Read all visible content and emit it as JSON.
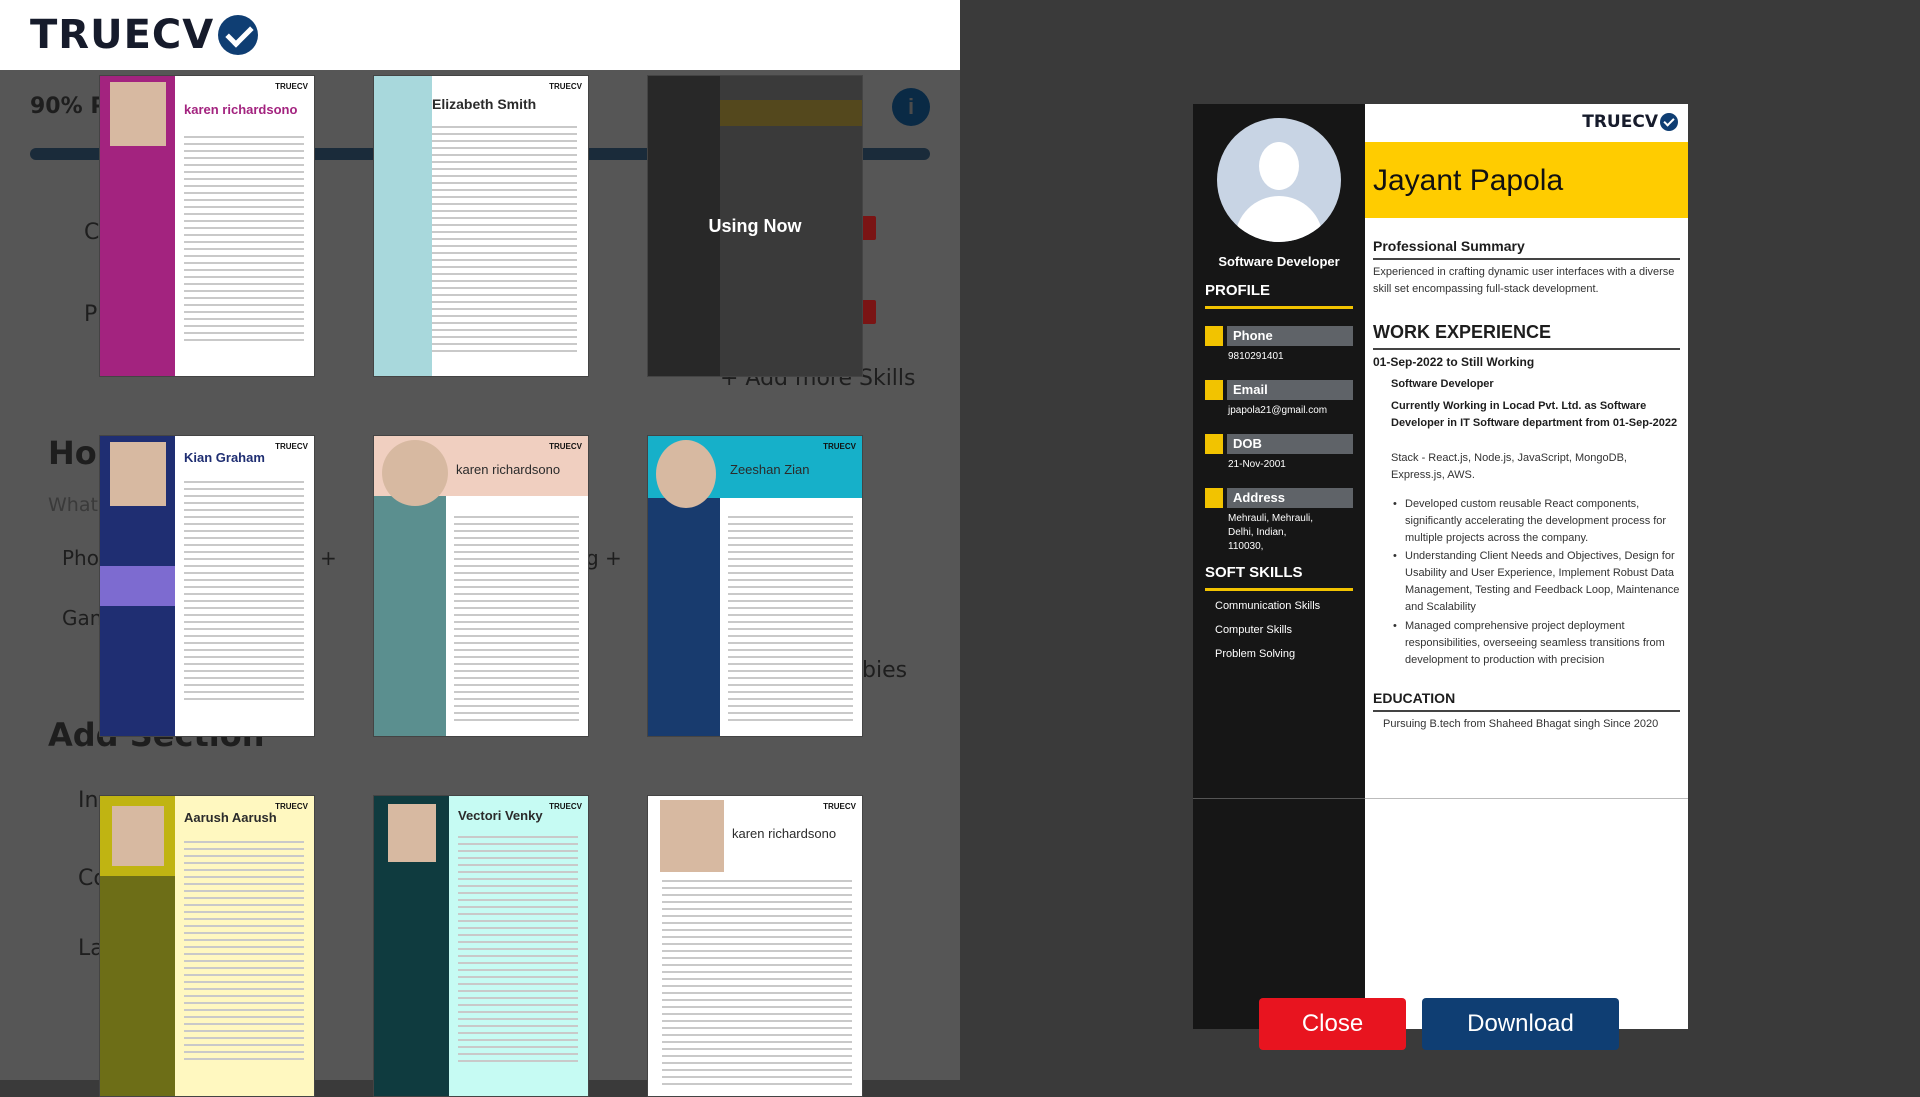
{
  "header": {
    "logo_text": "TRUECV",
    "logo_icon": "check-circle-icon"
  },
  "background_panel": {
    "progress_text": "90% P",
    "add_more_skills": "+ Add more Skills",
    "hobbies_heading": "Hol",
    "what_label": "What",
    "phone_partial": "Pho",
    "game_partial": "Gan",
    "bies_partial": "bies",
    "plus1": "+",
    "plus2": "g +",
    "add_section": "Add Section",
    "in_partial": "In",
    "co_partial": "Co",
    "la_partial": "La",
    "c_partial": "C",
    "p_partial": "P",
    "info_icon": "info-icon"
  },
  "templates": [
    {
      "name": "karen richardsono",
      "brand": "TRUECV"
    },
    {
      "name": "Elizabeth Smith",
      "brand": "TRUECV"
    },
    {
      "name": "",
      "brand": "",
      "overlay": "Using Now"
    },
    {
      "name": "Kian Graham",
      "brand": "TRUECV"
    },
    {
      "name": "karen richardsono",
      "brand": "TRUECV"
    },
    {
      "name": "Zeeshan Zian",
      "brand": "TRUECV"
    },
    {
      "name": "Aarush Aarush",
      "brand": "TRUECV"
    },
    {
      "name": "Vectori Venky",
      "brand": "TRUECV"
    },
    {
      "name": "karen richardsono",
      "brand": "TRUECV"
    }
  ],
  "resume": {
    "brand": "TRUECV",
    "name": "Jayant Papola",
    "role": "Software Developer",
    "profile_heading": "PROFILE",
    "phone_label": "Phone",
    "phone": "9810291401",
    "email_label": "Email",
    "email": "jpapola21@gmail.com",
    "dob_label": "DOB",
    "dob": "21-Nov-2001",
    "address_label": "Address",
    "address": "Mehrauli, Mehrauli, Delhi, Indian, 110030,",
    "soft_skills_heading": "SOFT SKILLS",
    "skills": [
      "Communication Skills",
      "Computer Skills",
      "Problem Solving"
    ],
    "summary_heading": "Professional Summary",
    "summary": "Experienced in crafting dynamic user interfaces with a diverse skill set encompassing full-stack development.",
    "work_heading": "WORK EXPERIENCE",
    "work_dates": "01-Sep-2022 to Still Working",
    "work_title": "Software Developer",
    "work_desc": "Currently Working in Locad Pvt. Ltd. as Software Developer in IT Software department from 01-Sep-2022",
    "work_stack": "Stack - React.js, Node.js, JavaScript, MongoDB, Express.js, AWS.",
    "bullets": [
      "Developed custom reusable React components, significantly accelerating the development process for multiple projects across the company.",
      "Understanding Client Needs and Objectives, Design for Usability and User Experience, Implement Robust Data Management, Testing and Feedback Loop, Maintenance and Scalability",
      "Managed comprehensive project deployment responsibilities, overseeing seamless transitions from development to production with precision"
    ],
    "education_heading": "EDUCATION",
    "education": "Pursuing B.tech from Shaheed Bhagat singh Since 2020"
  },
  "buttons": {
    "close": "Close",
    "download": "Download"
  },
  "colors": {
    "accent": "#ffcc00",
    "close": "#e8141f",
    "download": "#0f3e73"
  }
}
